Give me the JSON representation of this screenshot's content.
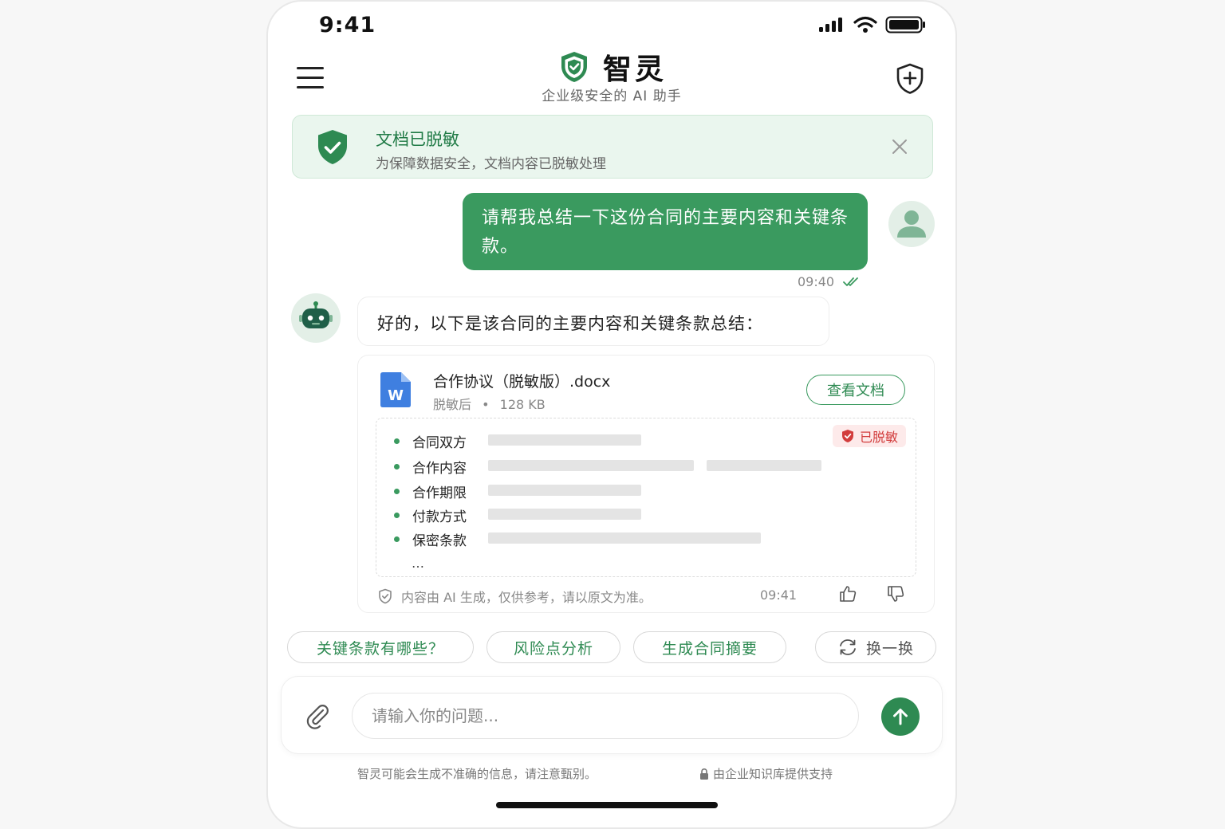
{
  "status_bar": {
    "time": "9:41"
  },
  "header": {
    "app_name": "智灵",
    "subtitle": "企业级安全的 AI 助手"
  },
  "banner": {
    "title": "文档已脱敏",
    "text": "为保障数据安全，文档内容已脱敏处理"
  },
  "user_message": {
    "text": "请帮我总结一下这份合同的主要内容和关键条款。",
    "time": "09:40"
  },
  "assistant": {
    "text": "好的，以下是该合同的主要内容和关键条款总结：",
    "document": {
      "file_icon_letter": "W",
      "name": "合作协议（脱敏版）.docx",
      "status": "脱敏后",
      "separator": "•",
      "size": "128 KB",
      "view_button": "查看文档"
    },
    "summary": {
      "badge": "已脱敏",
      "items": [
        "合同双方",
        "合作内容",
        "合作期限",
        "付款方式",
        "保密条款"
      ],
      "more": "…"
    },
    "disclaimer": "内容由 AI 生成，仅供参考，请以原文为准。",
    "time": "09:41"
  },
  "suggestions": [
    "关键条款有哪些？",
    "风险点分析",
    "生成合同摘要"
  ],
  "refresh_label": "换一换",
  "composer": {
    "placeholder": "请输入你的问题..."
  },
  "footer": {
    "left": "智灵可能会生成不准确的信息，请注意甄别。",
    "right": "由企业知识库提供支持"
  },
  "colors": {
    "brand_green": "#2e8a52",
    "bubble_green": "#3a9a5f",
    "banner_bg": "#eaf6ee",
    "alert_red": "#d23c3c"
  }
}
